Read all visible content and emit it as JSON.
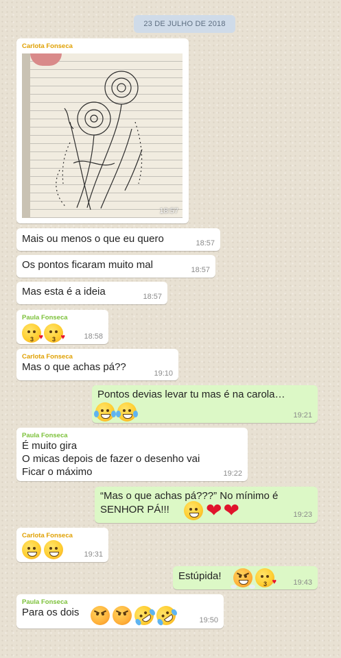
{
  "date_label": "23 DE JULHO DE 2018",
  "senders": {
    "carlota": "Carlota Fonseca",
    "paula": "Paula Fonseca"
  },
  "messages": [
    {
      "sender": "Carlota Fonseca",
      "type": "image",
      "time": "18:57",
      "image_description": "sketch of flowers on lined notebook paper"
    },
    {
      "text": "Mais ou menos o que eu quero",
      "time": "18:57"
    },
    {
      "text": "Os pontos ficaram muito mal",
      "time": "18:57"
    },
    {
      "text": "Mas esta é a ideia",
      "time": "18:57"
    },
    {
      "sender": "Paula Fonseca",
      "emojis": [
        "kissing-heart-icon",
        "kissing-heart-icon"
      ],
      "time": "18:58"
    },
    {
      "sender": "Carlota Fonseca",
      "text": "Mas o que achas pá??",
      "time": "19:10"
    },
    {
      "outgoing": true,
      "text": "Pontos devias levar tu mas é na carola…",
      "emojis": [
        "tears-of-joy-icon",
        "tears-of-joy-icon"
      ],
      "time": "19:21"
    },
    {
      "sender": "Paula Fonseca",
      "lines": [
        "É muito gira",
        "O micas depois de fazer o desenho vai",
        "Ficar o máximo"
      ],
      "time": "19:22"
    },
    {
      "outgoing": true,
      "lines": [
        "“Mas o que achas pá???” No mínimo é",
        "SENHOR PÁ!!!"
      ],
      "emojis": [
        "grin-icon",
        "heart-icon",
        "heart-icon"
      ],
      "time": "19:23"
    },
    {
      "sender": "Carlota Fonseca",
      "emojis": [
        "grin-icon",
        "grin-icon"
      ],
      "time": "19:31"
    },
    {
      "outgoing": true,
      "text": "Estúpida!",
      "emojis": [
        "triumph-icon",
        "kissing-heart-icon"
      ],
      "time": "19:43"
    },
    {
      "sender": "Paula Fonseca",
      "text": "Para os dois",
      "emojis": [
        "angry-icon",
        "angry-icon",
        "rolling-laughing-icon",
        "rolling-laughing-icon"
      ],
      "time": "19:50"
    }
  ],
  "colors": {
    "incoming": "#ffffff",
    "outgoing": "#dcf8c6",
    "carlota_name": "#e0a000",
    "paula_name": "#7cc13a",
    "date_bg": "#cfdbe9"
  }
}
